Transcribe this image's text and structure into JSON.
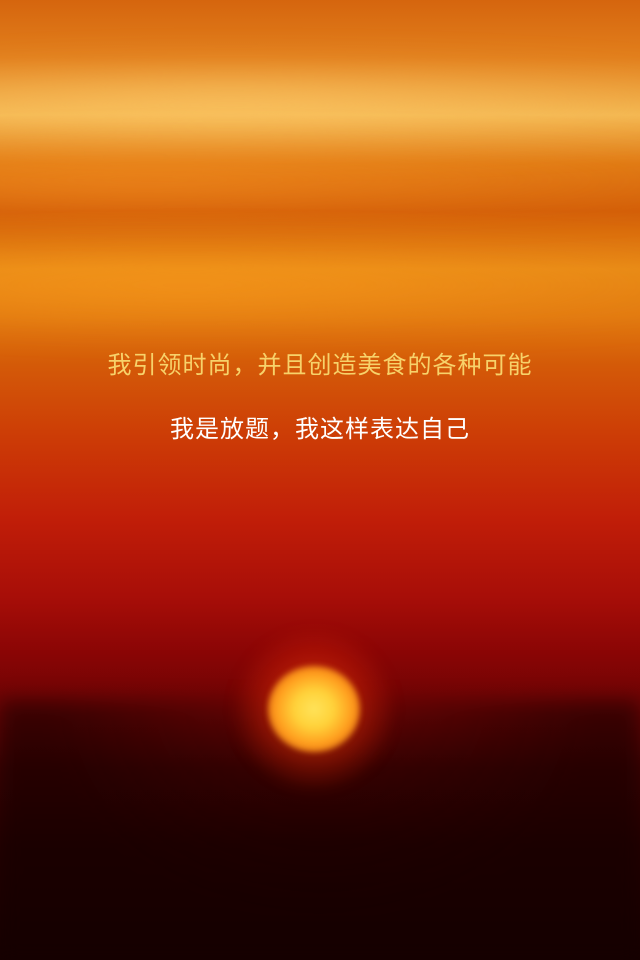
{
  "splash": {
    "headline": "我引领时尚，并且创造美食的各种可能",
    "subline": "我是放题，我这样表达自己",
    "headline_color": "#f7d26a",
    "subline_color": "#ffffff"
  },
  "background": {
    "scene": "sunset",
    "sky_top_color": "#d5650e",
    "sky_mid_color": "#c11e08",
    "ground_color": "#160101",
    "sun_color": "#ffd23a"
  }
}
